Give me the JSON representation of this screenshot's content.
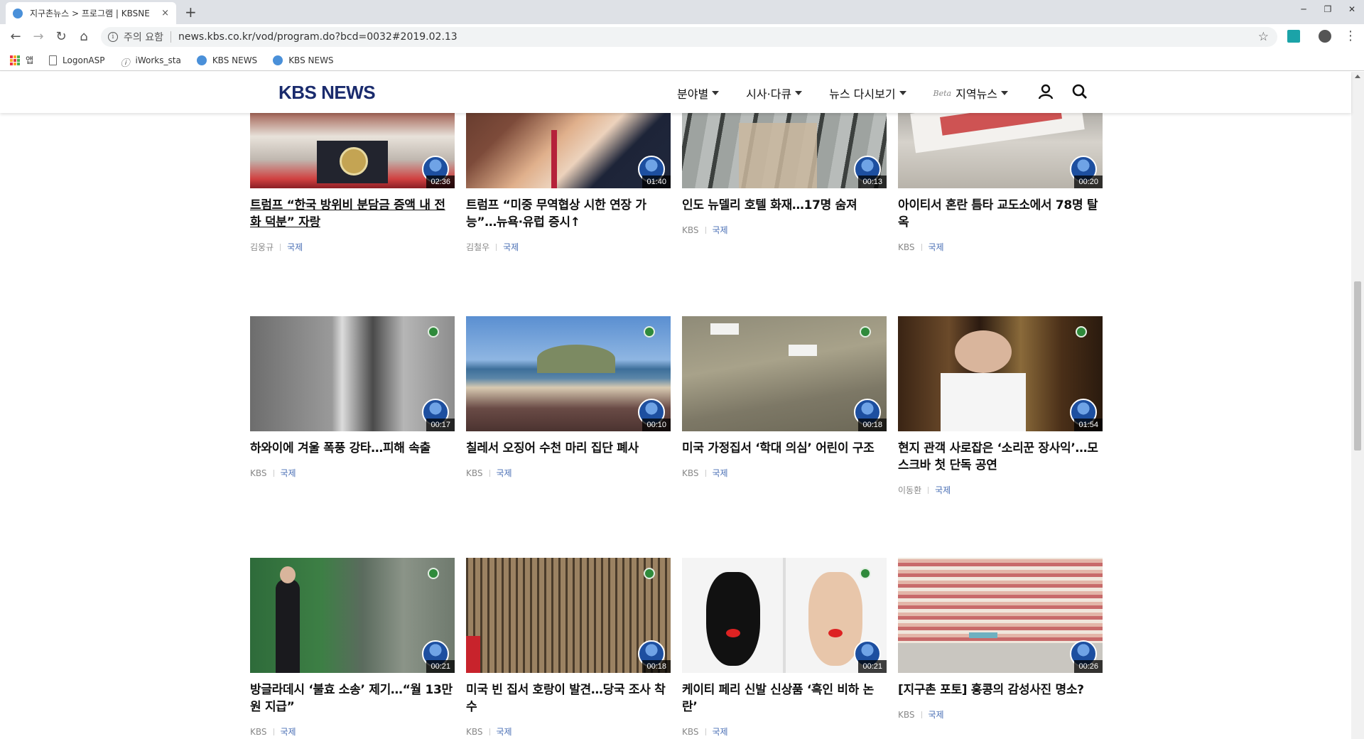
{
  "browser": {
    "tab_title": "지구촌뉴스 > 프로그램 | KBSNE",
    "tab_close": "×",
    "new_tab": "+",
    "window_controls": [
      "─",
      "❐",
      "✕"
    ],
    "nav": {
      "back": "←",
      "forward": "→",
      "reload": "↻",
      "home": "⌂"
    },
    "security_label": "주의 요함",
    "url": "news.kbs.co.kr/vod/program.do?bcd=0032#2019.02.13",
    "star": "☆",
    "menu": "⋮",
    "bookmarks": [
      "앱",
      "LogonASP",
      "iWorks_sta",
      "KBS NEWS",
      "KBS NEWS"
    ]
  },
  "site": {
    "logo": "KBS NEWS",
    "nav": [
      {
        "label": "분야별"
      },
      {
        "label": "시사·다큐"
      },
      {
        "label": "뉴스 다시보기"
      },
      {
        "label": "지역뉴스",
        "beta": "Beta"
      }
    ]
  },
  "cards": [
    {
      "title": "트럼프 “한국 방위비 분담금 증액 내 전화 덕분” 자랑",
      "duration": "02:36",
      "author": "김웅규",
      "category": "국제",
      "underline": true
    },
    {
      "title": "트럼프 “미중 무역협상 시한 연장 가능”…뉴욕·유럽 증시↑",
      "duration": "01:40",
      "author": "김철우",
      "category": "국제"
    },
    {
      "title": "인도 뉴델리 호텔 화재…17명 숨져",
      "duration": "00:13",
      "author": "KBS",
      "category": "국제"
    },
    {
      "title": "아이티서 혼란 틈타 교도소에서 78명 탈옥",
      "duration": "00:20",
      "author": "KBS",
      "category": "국제"
    },
    {
      "title": "하와이에 겨울 폭풍 강타…피해 속출",
      "duration": "00:17",
      "author": "KBS",
      "category": "국제"
    },
    {
      "title": "칠레서 오징어 수천 마리 집단 폐사",
      "duration": "00:10",
      "author": "KBS",
      "category": "국제"
    },
    {
      "title": "미국 가정집서 ‘학대 의심’ 어린이 구조",
      "duration": "00:18",
      "author": "KBS",
      "category": "국제"
    },
    {
      "title": "현지 관객 사로잡은 ‘소리꾼 장사익’…모스크바 첫 단독 공연",
      "duration": "01:54",
      "author": "이동환",
      "category": "국제"
    },
    {
      "title": "방글라데시 ‘불효 소송’ 제기…“월 13만 원 지급”",
      "duration": "00:21",
      "author": "KBS",
      "category": "국제"
    },
    {
      "title": "미국 빈 집서 호랑이 발견…당국 조사 착수",
      "duration": "00:18",
      "author": "KBS",
      "category": "국제"
    },
    {
      "title": "케이티 페리 신발 신상품 ‘흑인 비하 논란’",
      "duration": "00:21",
      "author": "KBS",
      "category": "국제"
    },
    {
      "title": "[지구촌 포토] 홍콩의 감성사진 명소?",
      "duration": "00:26",
      "author": "KBS",
      "category": "국제"
    }
  ]
}
